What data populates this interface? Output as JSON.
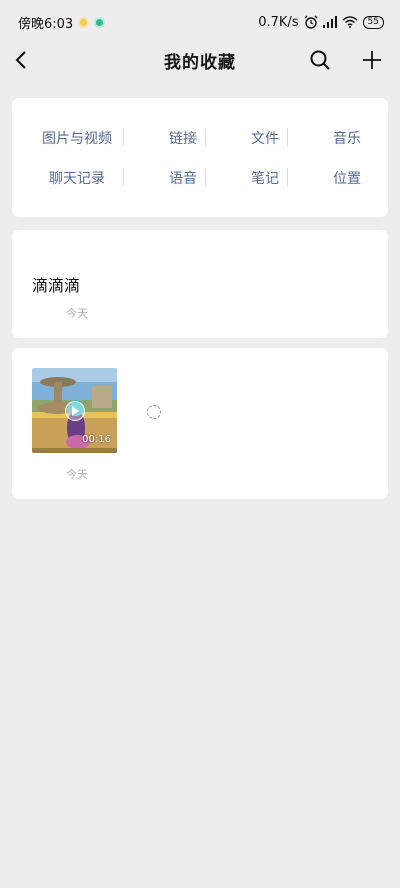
{
  "status_bar": {
    "time": "傍晚6:03",
    "network_speed": "0.7K/s",
    "battery": "55"
  },
  "nav": {
    "title": "我的收藏"
  },
  "categories": {
    "row1": [
      "图片与视频",
      "链接",
      "文件",
      "音乐"
    ],
    "row2": [
      "聊天记录",
      "语音",
      "笔记",
      "位置"
    ]
  },
  "favorites": [
    {
      "type": "text",
      "content": "滴滴滴",
      "date": "今天"
    },
    {
      "type": "video",
      "duration": "00:16",
      "date": "今天"
    }
  ],
  "colors": {
    "background": "#ededed",
    "category_link": "#576b95",
    "date_text": "#b2b2b2"
  }
}
